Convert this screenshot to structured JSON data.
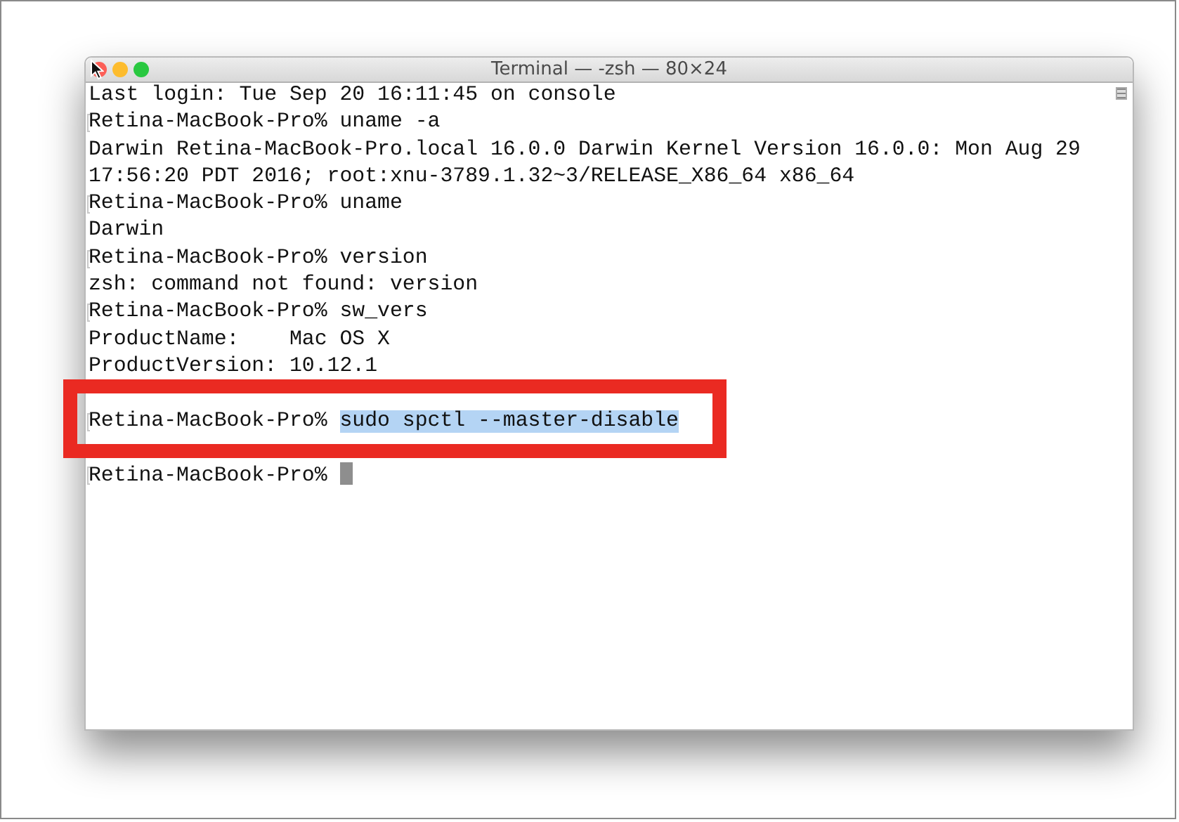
{
  "window": {
    "title": "Terminal — -zsh — 80×24"
  },
  "terminal": {
    "lines": [
      {
        "kind": "output",
        "text": "Last login: Tue Sep 20 16:11:45 on console"
      },
      {
        "kind": "prompt",
        "prompt": "Retina-MacBook-Pro%",
        "command": "uname -a",
        "selected": false,
        "cursor": false
      },
      {
        "kind": "output",
        "text": "Darwin Retina-MacBook-Pro.local 16.0.0 Darwin Kernel Version 16.0.0: Mon Aug 29"
      },
      {
        "kind": "output",
        "text": "17:56:20 PDT 2016; root:xnu-3789.1.32~3/RELEASE_X86_64 x86_64"
      },
      {
        "kind": "prompt",
        "prompt": "Retina-MacBook-Pro%",
        "command": "uname",
        "selected": false,
        "cursor": false
      },
      {
        "kind": "output",
        "text": "Darwin"
      },
      {
        "kind": "prompt",
        "prompt": "Retina-MacBook-Pro%",
        "command": "version",
        "selected": false,
        "cursor": false
      },
      {
        "kind": "output",
        "text": "zsh: command not found: version"
      },
      {
        "kind": "prompt",
        "prompt": "Retina-MacBook-Pro%",
        "command": "sw_vers",
        "selected": false,
        "cursor": false
      },
      {
        "kind": "output",
        "text": "ProductName:    Mac OS X"
      },
      {
        "kind": "output",
        "text": "ProductVersion: 10.12.1"
      },
      {
        "kind": "covered"
      },
      {
        "kind": "prompt",
        "prompt": "Retina-MacBook-Pro%",
        "command": "sudo spctl --master-disable",
        "selected": true,
        "cursor": false
      },
      {
        "kind": "covered"
      },
      {
        "kind": "prompt",
        "prompt": "Retina-MacBook-Pro%",
        "cursor": true
      }
    ]
  }
}
